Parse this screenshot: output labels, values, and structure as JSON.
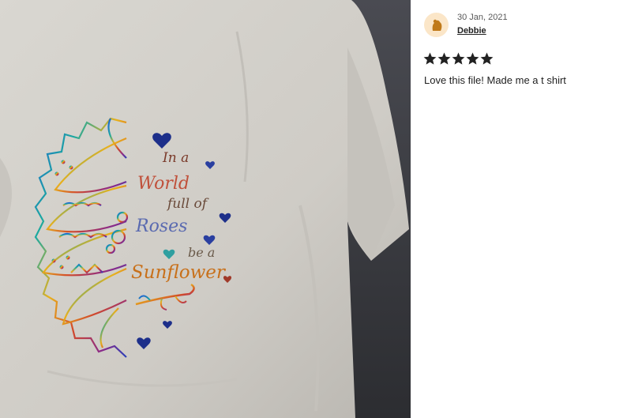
{
  "photo": {
    "alt_subject": "t-shirt-photo",
    "print_lines": [
      "In a",
      "World",
      "full of",
      "Roses",
      "be a",
      "Sunflower"
    ]
  },
  "review": {
    "date": "30 Jan, 2021",
    "username": "Debbie",
    "rating": 5,
    "rating_max": 5,
    "text": "Love this file! Made me a t shirt",
    "colors": {
      "star": "#222222",
      "avatar_bg": "#fbe6c8",
      "avatar_fg": "#c07a1a"
    }
  }
}
